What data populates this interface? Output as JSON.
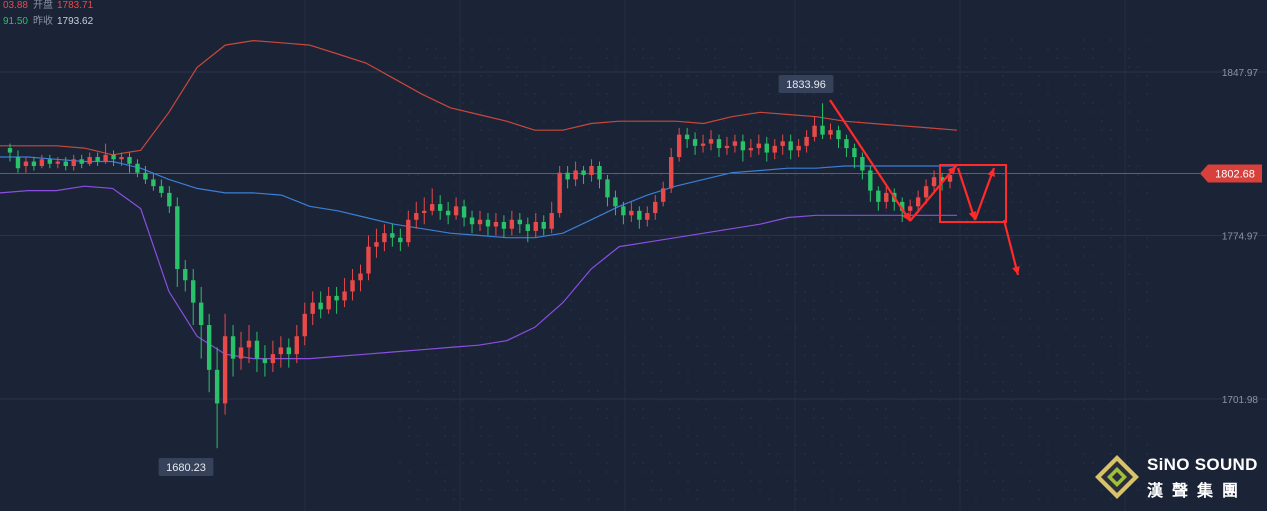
{
  "header": {
    "row1": {
      "value": "03.88",
      "label": "开盘",
      "value2": "1783.71"
    },
    "row2": {
      "value": "91.50",
      "label": "昨收",
      "value2": "1793.62"
    }
  },
  "logo": {
    "brand": "SiNO SOUND",
    "brand_cn": "漢聲集團"
  },
  "colors": {
    "up": "#e84a4a",
    "down": "#29c16a",
    "upper_band": "#c8483c",
    "middle_band": "#3b7fd6",
    "lower_band": "#8a4fe0",
    "annotation": "#ff2a2a",
    "background": "#1b2336"
  },
  "chart_data": {
    "type": "candlestick",
    "y_axis": {
      "ticks": [
        1847.97,
        1802.68,
        1774.97,
        1701.98
      ],
      "ylim": [
        1660,
        1880
      ],
      "position": "right"
    },
    "current_price": 1802.68,
    "annotations": [
      {
        "text": "1833.96",
        "type": "high"
      },
      {
        "text": "1680.23",
        "type": "low"
      }
    ],
    "upper_band": [
      1815,
      1815,
      1815,
      1814,
      1811,
      1813,
      1830,
      1850,
      1860,
      1862,
      1861,
      1860,
      1856,
      1852,
      1845,
      1838,
      1832,
      1829,
      1826,
      1822,
      1822,
      1825,
      1826,
      1826,
      1826,
      1825,
      1828,
      1830,
      1829,
      1828,
      1826,
      1825,
      1824,
      1823,
      1822
    ],
    "middle_band": [
      1810,
      1810,
      1809,
      1808,
      1808,
      1805,
      1800,
      1796,
      1794,
      1794,
      1793,
      1788,
      1786,
      1783,
      1780,
      1778,
      1776,
      1775,
      1774,
      1774,
      1776,
      1782,
      1788,
      1793,
      1797,
      1800,
      1803,
      1804,
      1805,
      1805,
      1806,
      1806,
      1806,
      1806,
      1806
    ],
    "lower_band": [
      1794,
      1795,
      1795,
      1797,
      1796,
      1787,
      1750,
      1730,
      1722,
      1720,
      1720,
      1720,
      1721,
      1722,
      1723,
      1724,
      1725,
      1726,
      1728,
      1734,
      1745,
      1760,
      1770,
      1772,
      1774,
      1776,
      1778,
      1780,
      1783,
      1784,
      1784,
      1784,
      1784,
      1784,
      1784
    ],
    "candles": [
      [
        1814,
        1812,
        1816,
        1808
      ],
      [
        1810,
        1805,
        1813,
        1803
      ],
      [
        1806,
        1808,
        1810,
        1803
      ],
      [
        1808,
        1806,
        1810,
        1804
      ],
      [
        1806,
        1809,
        1811,
        1805
      ],
      [
        1809,
        1807,
        1811,
        1805
      ],
      [
        1807,
        1808,
        1810,
        1805
      ],
      [
        1808,
        1806,
        1810,
        1804
      ],
      [
        1806,
        1809,
        1811,
        1804
      ],
      [
        1809,
        1807,
        1811,
        1805
      ],
      [
        1807,
        1810,
        1812,
        1806
      ],
      [
        1810,
        1808,
        1812,
        1806
      ],
      [
        1808,
        1811,
        1816,
        1807
      ],
      [
        1811,
        1809,
        1813,
        1806
      ],
      [
        1809,
        1810,
        1812,
        1806
      ],
      [
        1810,
        1807,
        1812,
        1803
      ],
      [
        1807,
        1803,
        1809,
        1801
      ],
      [
        1803,
        1800,
        1806,
        1798
      ],
      [
        1800,
        1797,
        1803,
        1795
      ],
      [
        1797,
        1794,
        1800,
        1792
      ],
      [
        1794,
        1788,
        1797,
        1785
      ],
      [
        1788,
        1760,
        1792,
        1752
      ],
      [
        1760,
        1755,
        1764,
        1750
      ],
      [
        1755,
        1745,
        1760,
        1735
      ],
      [
        1745,
        1735,
        1752,
        1720
      ],
      [
        1735,
        1715,
        1740,
        1705
      ],
      [
        1715,
        1700,
        1725,
        1680
      ],
      [
        1700,
        1730,
        1740,
        1695
      ],
      [
        1730,
        1720,
        1735,
        1712
      ],
      [
        1720,
        1725,
        1732,
        1715
      ],
      [
        1725,
        1728,
        1735,
        1718
      ],
      [
        1728,
        1720,
        1732,
        1714
      ],
      [
        1720,
        1718,
        1726,
        1712
      ],
      [
        1718,
        1722,
        1728,
        1714
      ],
      [
        1722,
        1725,
        1730,
        1716
      ],
      [
        1725,
        1722,
        1729,
        1716
      ],
      [
        1722,
        1730,
        1735,
        1718
      ],
      [
        1730,
        1740,
        1745,
        1726
      ],
      [
        1740,
        1745,
        1750,
        1735
      ],
      [
        1745,
        1742,
        1750,
        1738
      ],
      [
        1742,
        1748,
        1752,
        1740
      ],
      [
        1748,
        1746,
        1752,
        1740
      ],
      [
        1746,
        1750,
        1756,
        1743
      ],
      [
        1750,
        1755,
        1760,
        1746
      ],
      [
        1755,
        1758,
        1762,
        1750
      ],
      [
        1758,
        1770,
        1775,
        1755
      ],
      [
        1770,
        1772,
        1778,
        1765
      ],
      [
        1772,
        1776,
        1780,
        1768
      ],
      [
        1776,
        1774,
        1780,
        1770
      ],
      [
        1774,
        1772,
        1778,
        1768
      ],
      [
        1772,
        1782,
        1786,
        1770
      ],
      [
        1782,
        1785,
        1790,
        1778
      ],
      [
        1785,
        1786,
        1792,
        1780
      ],
      [
        1786,
        1789,
        1796,
        1784
      ],
      [
        1789,
        1786,
        1793,
        1782
      ],
      [
        1786,
        1784,
        1790,
        1780
      ],
      [
        1784,
        1788,
        1792,
        1782
      ],
      [
        1788,
        1783,
        1791,
        1779
      ],
      [
        1783,
        1780,
        1786,
        1776
      ],
      [
        1780,
        1782,
        1786,
        1777
      ],
      [
        1782,
        1779,
        1785,
        1775
      ],
      [
        1779,
        1781,
        1785,
        1775
      ],
      [
        1781,
        1778,
        1784,
        1774
      ],
      [
        1778,
        1782,
        1786,
        1775
      ],
      [
        1782,
        1780,
        1785,
        1776
      ],
      [
        1780,
        1777,
        1783,
        1772
      ],
      [
        1777,
        1781,
        1785,
        1774
      ],
      [
        1781,
        1778,
        1784,
        1775
      ],
      [
        1778,
        1785,
        1790,
        1776
      ],
      [
        1785,
        1803,
        1806,
        1783
      ],
      [
        1803,
        1800,
        1806,
        1796
      ],
      [
        1800,
        1804,
        1808,
        1797
      ],
      [
        1804,
        1802,
        1806,
        1798
      ],
      [
        1802,
        1806,
        1809,
        1799
      ],
      [
        1806,
        1800,
        1808,
        1796
      ],
      [
        1800,
        1792,
        1802,
        1788
      ],
      [
        1792,
        1788,
        1795,
        1784
      ],
      [
        1788,
        1784,
        1790,
        1780
      ],
      [
        1784,
        1786,
        1790,
        1781
      ],
      [
        1786,
        1782,
        1788,
        1778
      ],
      [
        1782,
        1785,
        1788,
        1779
      ],
      [
        1785,
        1790,
        1793,
        1782
      ],
      [
        1790,
        1796,
        1799,
        1788
      ],
      [
        1796,
        1810,
        1814,
        1794
      ],
      [
        1810,
        1820,
        1823,
        1808
      ],
      [
        1820,
        1818,
        1823,
        1814
      ],
      [
        1818,
        1815,
        1821,
        1811
      ],
      [
        1815,
        1816,
        1820,
        1812
      ],
      [
        1816,
        1818,
        1822,
        1813
      ],
      [
        1818,
        1814,
        1820,
        1810
      ],
      [
        1814,
        1815,
        1819,
        1811
      ],
      [
        1815,
        1817,
        1820,
        1812
      ],
      [
        1817,
        1813,
        1820,
        1808
      ],
      [
        1813,
        1814,
        1818,
        1810
      ],
      [
        1814,
        1816,
        1820,
        1811
      ],
      [
        1816,
        1812,
        1819,
        1808
      ],
      [
        1812,
        1815,
        1818,
        1809
      ],
      [
        1815,
        1817,
        1820,
        1811
      ],
      [
        1817,
        1813,
        1820,
        1809
      ],
      [
        1813,
        1815,
        1818,
        1810
      ],
      [
        1815,
        1819,
        1822,
        1812
      ],
      [
        1819,
        1824,
        1828,
        1817
      ],
      [
        1824,
        1820,
        1834,
        1818
      ],
      [
        1820,
        1822,
        1825,
        1818
      ],
      [
        1822,
        1818,
        1824,
        1814
      ],
      [
        1818,
        1814,
        1820,
        1810
      ],
      [
        1814,
        1810,
        1816,
        1805
      ],
      [
        1810,
        1804,
        1812,
        1800
      ],
      [
        1804,
        1795,
        1806,
        1790
      ],
      [
        1795,
        1790,
        1797,
        1786
      ],
      [
        1790,
        1794,
        1797,
        1787
      ],
      [
        1794,
        1790,
        1796,
        1786
      ],
      [
        1790,
        1786,
        1792,
        1781
      ],
      [
        1786,
        1788,
        1791,
        1782
      ],
      [
        1788,
        1792,
        1795,
        1785
      ],
      [
        1792,
        1797,
        1800,
        1789
      ],
      [
        1797,
        1801,
        1804,
        1794
      ],
      [
        1801,
        1799,
        1803,
        1795
      ],
      [
        1799,
        1802,
        1805,
        1796
      ]
    ]
  }
}
